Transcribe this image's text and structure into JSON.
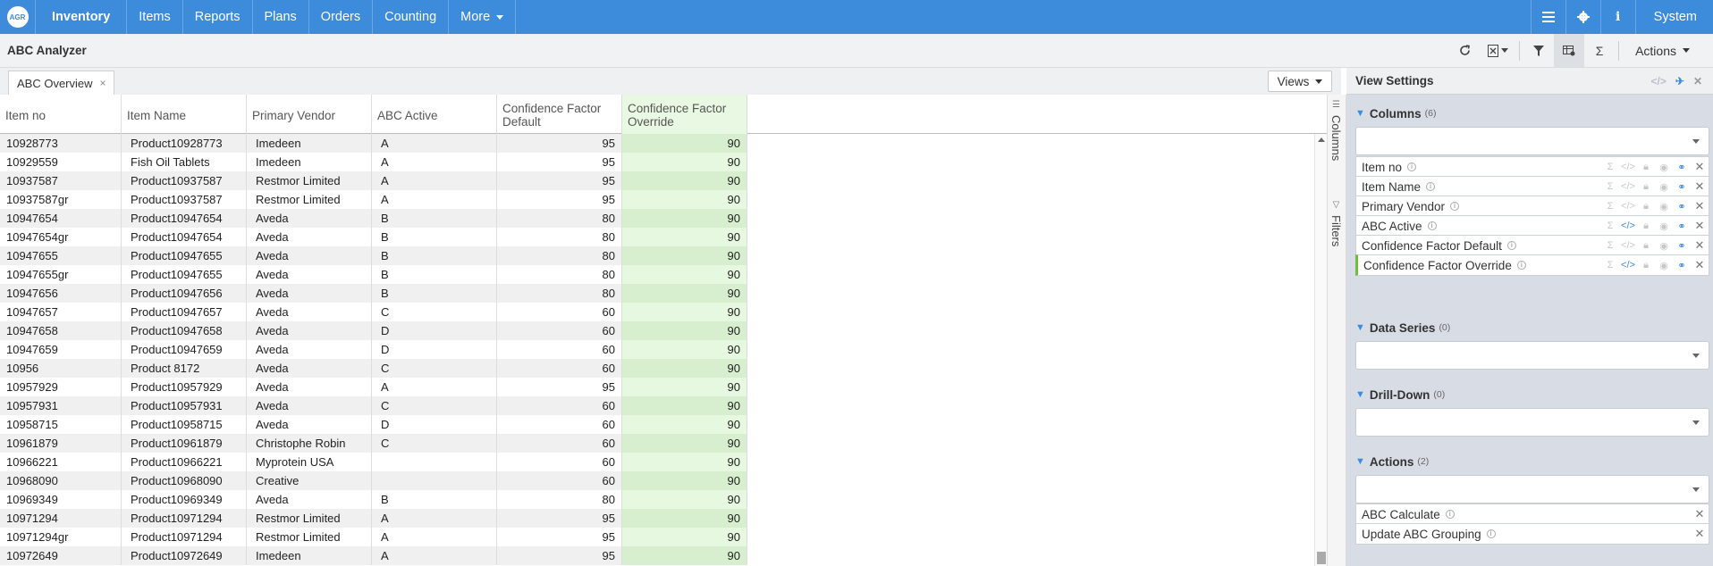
{
  "nav": {
    "logo": "AGR",
    "items": [
      "Inventory",
      "Items",
      "Reports",
      "Plans",
      "Orders",
      "Counting",
      "More"
    ],
    "system": "System"
  },
  "subbar": {
    "title": "ABC Analyzer",
    "actions": "Actions"
  },
  "tabstrip": {
    "tab": "ABC Overview",
    "tab_close": "×",
    "views": "Views"
  },
  "grid": {
    "headers": [
      "Item no",
      "Item Name",
      "Primary Vendor",
      "ABC Active",
      "Confidence Factor Default",
      "Confidence Factor Override"
    ],
    "rows": [
      [
        "10928773",
        "Product10928773",
        "Imedeen",
        "A",
        "95",
        "90"
      ],
      [
        "10929559",
        "Fish Oil Tablets",
        "Imedeen",
        "A",
        "95",
        "90"
      ],
      [
        "10937587",
        "Product10937587",
        "Restmor Limited",
        "A",
        "95",
        "90"
      ],
      [
        "10937587gr",
        "Product10937587",
        "Restmor Limited",
        "A",
        "95",
        "90"
      ],
      [
        "10947654",
        "Product10947654",
        "Aveda",
        "B",
        "80",
        "90"
      ],
      [
        "10947654gr",
        "Product10947654",
        "Aveda",
        "B",
        "80",
        "90"
      ],
      [
        "10947655",
        "Product10947655",
        "Aveda",
        "B",
        "80",
        "90"
      ],
      [
        "10947655gr",
        "Product10947655",
        "Aveda",
        "B",
        "80",
        "90"
      ],
      [
        "10947656",
        "Product10947656",
        "Aveda",
        "B",
        "80",
        "90"
      ],
      [
        "10947657",
        "Product10947657",
        "Aveda",
        "C",
        "60",
        "90"
      ],
      [
        "10947658",
        "Product10947658",
        "Aveda",
        "D",
        "60",
        "90"
      ],
      [
        "10947659",
        "Product10947659",
        "Aveda",
        "D",
        "60",
        "90"
      ],
      [
        "10956",
        "Product 8172",
        "Aveda",
        "C",
        "60",
        "90"
      ],
      [
        "10957929",
        "Product10957929",
        "Aveda",
        "A",
        "95",
        "90"
      ],
      [
        "10957931",
        "Product10957931",
        "Aveda",
        "C",
        "60",
        "90"
      ],
      [
        "10958715",
        "Product10958715",
        "Aveda",
        "D",
        "60",
        "90"
      ],
      [
        "10961879",
        "Product10961879",
        "Christophe Robin",
        "C",
        "60",
        "90"
      ],
      [
        "10966221",
        "Product10966221",
        "Myprotein USA",
        "",
        "60",
        "90"
      ],
      [
        "10968090",
        "Product10968090",
        "Creative",
        "",
        "60",
        "90"
      ],
      [
        "10969349",
        "Product10969349",
        "Aveda",
        "B",
        "80",
        "90"
      ],
      [
        "10971294",
        "Product10971294",
        "Restmor Limited",
        "A",
        "95",
        "90"
      ],
      [
        "10971294gr",
        "Product10971294",
        "Restmor Limited",
        "A",
        "95",
        "90"
      ],
      [
        "10972649",
        "Product10972649",
        "Imedeen",
        "A",
        "95",
        "90"
      ]
    ]
  },
  "sidestrip": {
    "columns": "Columns",
    "filters": "Filters"
  },
  "panel": {
    "title": "View Settings",
    "columns": {
      "label": "Columns",
      "count": "(6)",
      "items": [
        "Item no",
        "Item Name",
        "Primary Vendor",
        "ABC Active",
        "Confidence Factor Default",
        "Confidence Factor Override"
      ]
    },
    "data_series": {
      "label": "Data Series",
      "count": "(0)"
    },
    "drill_down": {
      "label": "Drill-Down",
      "count": "(0)"
    },
    "actions": {
      "label": "Actions",
      "count": "(2)",
      "items": [
        "ABC Calculate",
        "Update ABC Grouping"
      ]
    }
  }
}
